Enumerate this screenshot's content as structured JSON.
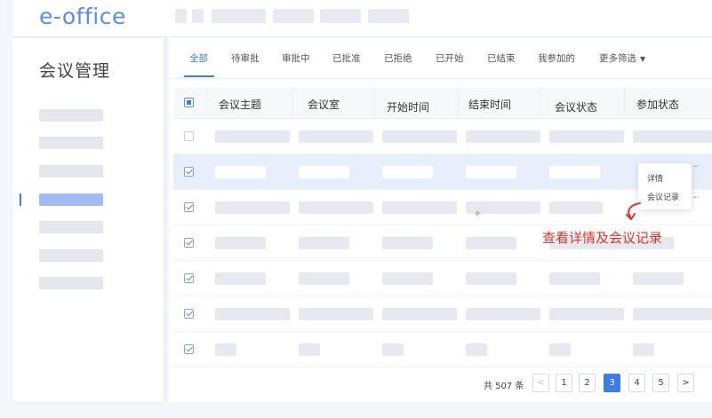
{
  "app": {
    "logo": "e-office"
  },
  "sidebar": {
    "title": "会议管理"
  },
  "tabs": [
    {
      "label": "全部",
      "active": true
    },
    {
      "label": "待审批"
    },
    {
      "label": "审批中"
    },
    {
      "label": "已批准"
    },
    {
      "label": "已拒绝"
    },
    {
      "label": "已开始"
    },
    {
      "label": "已结束"
    },
    {
      "label": "我参加的"
    },
    {
      "label": "更多筛选"
    }
  ],
  "table": {
    "columns": [
      "会议主题",
      "会议室",
      "开始时间",
      "结束时间",
      "会议状态",
      "参加状态"
    ]
  },
  "context_menu": {
    "items": [
      "详情",
      "会议记录"
    ]
  },
  "annotation": "查看详情及会议记录",
  "pagination": {
    "total_label": "共 507 条",
    "prev": "<",
    "next": ">",
    "pages": [
      "1",
      "2",
      "3",
      "4",
      "5"
    ],
    "current": "3"
  },
  "colors": {
    "accent": "#3d7de8",
    "annotation": "#e3342f",
    "logo": "#5a8de8"
  }
}
